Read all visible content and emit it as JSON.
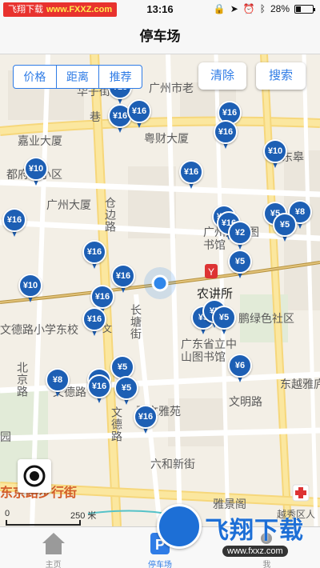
{
  "status_bar": {
    "watermark_text": "飞翔下载",
    "watermark_url": "www.FXXZ.com",
    "time": "13:16",
    "battery": "28%",
    "battery_level": 0.28
  },
  "nav": {
    "title": "停车场"
  },
  "filters": {
    "segments": [
      "价格",
      "距离",
      "推荐"
    ],
    "clear_label": "清除",
    "search_label": "搜索"
  },
  "map_labels": {
    "huazi": "华子街",
    "guangzhou_shi_lao": "广州市老",
    "jia_ye_da_sha": "嘉业大厦",
    "yue_cai_da_sha": "粤财大厦",
    "du_wai_zhu_xiao_qu": "都府住小区",
    "guang_zhou_da_sha": "广州大厦",
    "cang_bian_lu": "仓边路",
    "er_tong_tu_shu": "广州儿童图书馆",
    "nong_jiang_suo": "农讲所",
    "chang_tang_jie": "长塘街",
    "wen_de_xiao_xue": "文德路小学东校",
    "wen": "文",
    "lv_se_she_qu": "鹏绿色社区",
    "guang_dong_tu_shu_guan": "广东省立中山图书馆",
    "bei_jing_lu": "北京路",
    "wen_de_lu_a": "文德路",
    "dong_yue_ya": "东越雅庐",
    "wen_ming_lu": "文明路",
    "wen_ya_yuan": "骏文雅苑",
    "wen_de_lu_b": "文德路",
    "yuan": "园",
    "liu_he_xin_jie": "六和新街",
    "dong_xiao_lu": "东京路步行街",
    "ya_jing_ge": "雅景阁",
    "yue_xiu_ya": "越秀区人",
    "dong_gao": "东皋",
    "xiang_gang": "巷",
    "scale_zero": "0",
    "scale_250": "250 米"
  },
  "pins": [
    "¥16",
    "¥16",
    "¥16",
    "¥16",
    "¥16",
    "¥16",
    "¥10",
    "¥10",
    "¥16",
    "¥16",
    "¥16",
    "¥5",
    "¥8",
    "¥5",
    "¥2",
    "¥16",
    "¥5",
    "¥16",
    "¥10",
    "¥16",
    "¥16",
    "¥5",
    "¥5",
    "¥5",
    "¥16",
    "¥5",
    "¥8",
    "¥16",
    "¥5",
    "¥16",
    "¥6"
  ],
  "tabs": [
    {
      "label": "主页",
      "icon": "home-icon"
    },
    {
      "label": "停车场",
      "icon": "parking-icon"
    },
    {
      "label": "我",
      "icon": "person-icon"
    }
  ],
  "bottom_watermark": {
    "title": "飞翔下载",
    "url": "www.fxxz.com"
  },
  "colors": {
    "accent": "#2f7ce6",
    "pin": "#1d5fb4",
    "metro": "#d33",
    "location": "#2f86ea"
  }
}
